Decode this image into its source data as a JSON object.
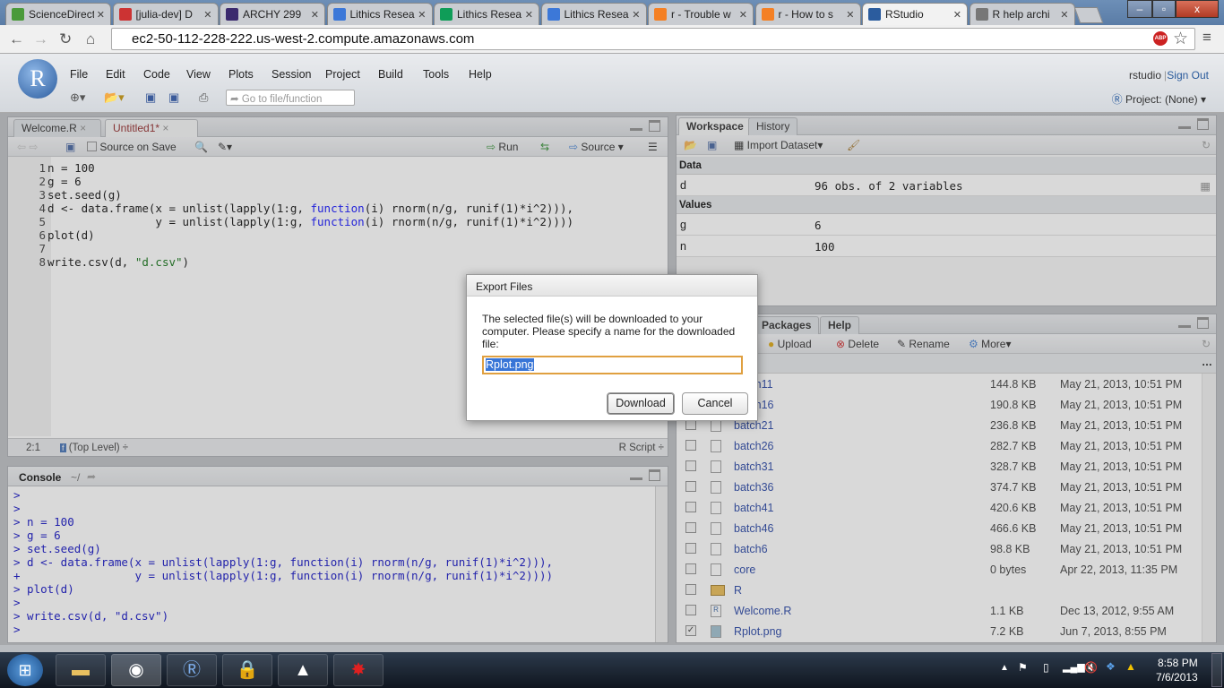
{
  "browser": {
    "tabs": [
      {
        "label": "ScienceDirect",
        "icon": "sciencedirect-icon",
        "color": "#4a9a3a"
      },
      {
        "label": "[julia-dev] D",
        "icon": "gmail-icon",
        "color": "#c33"
      },
      {
        "label": "ARCHY 299",
        "icon": "uw-icon",
        "color": "#3b2a6e"
      },
      {
        "label": "Lithics Resea",
        "icon": "google-docs-icon",
        "color": "#3c78d8"
      },
      {
        "label": "Lithics Resea",
        "icon": "google-sheets-icon",
        "color": "#0f9d58"
      },
      {
        "label": "Lithics Resea",
        "icon": "google-docs-icon",
        "color": "#3c78d8"
      },
      {
        "label": "r - Trouble w",
        "icon": "stackoverflow-icon",
        "color": "#f48024"
      },
      {
        "label": "r - How to s",
        "icon": "stackoverflow-icon",
        "color": "#f48024"
      },
      {
        "label": "RStudio",
        "icon": "rstudio-icon",
        "color": "#2b5c9e",
        "active": true
      },
      {
        "label": "R help archi",
        "icon": "r-help-icon",
        "color": "#777"
      }
    ],
    "url": "ec2-50-112-228-222.us-west-2.compute.amazonaws.com",
    "adblock_label": "ABP"
  },
  "rstudio": {
    "logo": "R",
    "menu": [
      "File",
      "Edit",
      "Code",
      "View",
      "Plots",
      "Session",
      "Project",
      "Build",
      "Tools",
      "Help"
    ],
    "goto_placeholder": "Go to file/function",
    "user": "rstudio",
    "signout": "Sign Out",
    "project": "Project: (None)",
    "source": {
      "tabs": [
        "Welcome.R",
        "Untitled1*"
      ],
      "source_on_save": "Source on Save",
      "run": "Run",
      "source_btn": "Source",
      "lines": [
        [
          {
            "t": "n = 100"
          }
        ],
        [
          {
            "t": "g = 6"
          }
        ],
        [
          {
            "t": "set.seed(g)"
          }
        ],
        [
          {
            "t": "d <- data.frame(x = unlist(lapply(1:g, "
          },
          {
            "t": "function",
            "k": 1
          },
          {
            "t": "(i) rnorm(n/g, runif(1)*i^2))),"
          }
        ],
        [
          {
            "t": "                y = unlist(lapply(1:g, "
          },
          {
            "t": "function",
            "k": 1
          },
          {
            "t": "(i) rnorm(n/g, runif(1)*i^2))))"
          }
        ],
        [
          {
            "t": "plot(d)"
          }
        ],
        [
          {
            "t": ""
          }
        ],
        [
          {
            "t": "write.csv(d, "
          },
          {
            "t": "\"d.csv\"",
            "s": 1
          },
          {
            "t": ")"
          }
        ]
      ],
      "status_pos": "2:1",
      "status_scope": "(Top Level)",
      "status_type": "R Script"
    },
    "console": {
      "title": "Console",
      "path": "~/",
      "lines": [
        "> ",
        "> ",
        "> n = 100",
        "> g = 6",
        "> set.seed(g)",
        "> d <- data.frame(x = unlist(lapply(1:g, function(i) rnorm(n/g, runif(1)*i^2))),",
        "+                 y = unlist(lapply(1:g, function(i) rnorm(n/g, runif(1)*i^2))))",
        "> plot(d)",
        "> ",
        "> write.csv(d, \"d.csv\")",
        "> "
      ]
    },
    "workspace": {
      "tabs": [
        "Workspace",
        "History"
      ],
      "import": "Import Dataset",
      "data_header": "Data",
      "data": [
        {
          "name": "d",
          "value": "96 obs. of 2 variables"
        }
      ],
      "values_header": "Values",
      "values": [
        {
          "name": "g",
          "value": "6"
        },
        {
          "name": "n",
          "value": "100"
        }
      ]
    },
    "files": {
      "tabs": [
        "Packages",
        "Help"
      ],
      "toolbar": [
        "Upload",
        "Delete",
        "Rename",
        "More"
      ],
      "rows": [
        {
          "name": "batch11",
          "size": "144.8 KB",
          "modified": "May 21, 2013, 10:51 PM",
          "checked": false,
          "type": "file"
        },
        {
          "name": "batch16",
          "size": "190.8 KB",
          "modified": "May 21, 2013, 10:51 PM",
          "checked": false,
          "type": "file"
        },
        {
          "name": "batch21",
          "size": "236.8 KB",
          "modified": "May 21, 2013, 10:51 PM",
          "checked": false,
          "type": "file"
        },
        {
          "name": "batch26",
          "size": "282.7 KB",
          "modified": "May 21, 2013, 10:51 PM",
          "checked": false,
          "type": "file"
        },
        {
          "name": "batch31",
          "size": "328.7 KB",
          "modified": "May 21, 2013, 10:51 PM",
          "checked": false,
          "type": "file"
        },
        {
          "name": "batch36",
          "size": "374.7 KB",
          "modified": "May 21, 2013, 10:51 PM",
          "checked": false,
          "type": "file"
        },
        {
          "name": "batch41",
          "size": "420.6 KB",
          "modified": "May 21, 2013, 10:51 PM",
          "checked": false,
          "type": "file"
        },
        {
          "name": "batch46",
          "size": "466.6 KB",
          "modified": "May 21, 2013, 10:51 PM",
          "checked": false,
          "type": "file"
        },
        {
          "name": "batch6",
          "size": "98.8 KB",
          "modified": "May 21, 2013, 10:51 PM",
          "checked": false,
          "type": "file"
        },
        {
          "name": "core",
          "size": "0 bytes",
          "modified": "Apr 22, 2013, 11:35 PM",
          "checked": false,
          "type": "file"
        },
        {
          "name": "R",
          "size": "",
          "modified": "",
          "checked": false,
          "type": "folder"
        },
        {
          "name": "Welcome.R",
          "size": "1.1 KB",
          "modified": "Dec 13, 2012, 9:55 AM",
          "checked": false,
          "type": "rfile"
        },
        {
          "name": "Rplot.png",
          "size": "7.2 KB",
          "modified": "Jun 7, 2013, 8:55 PM",
          "checked": true,
          "type": "image"
        }
      ]
    }
  },
  "dialog": {
    "title": "Export Files",
    "message": "The selected file(s) will be downloaded to your computer. Please specify a name for the downloaded file:",
    "filename": "Rplot.png",
    "download": "Download",
    "cancel": "Cancel"
  },
  "taskbar": {
    "time": "8:58 PM",
    "date": "7/6/2013"
  }
}
